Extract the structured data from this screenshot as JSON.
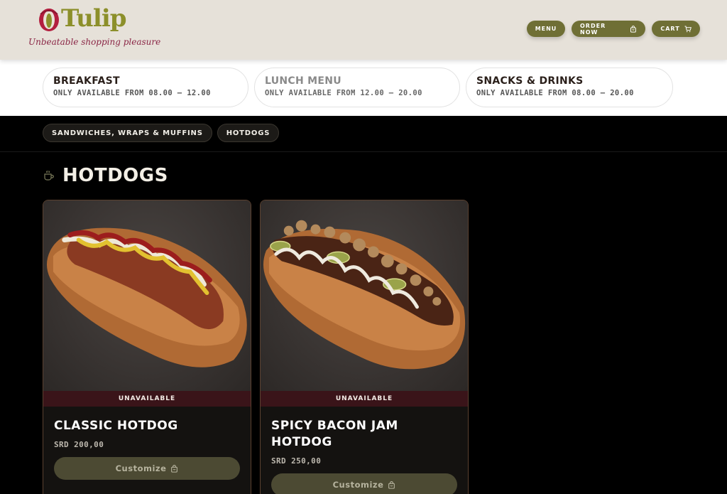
{
  "brand": {
    "name": "Tulip",
    "tagline": "Unbeatable shopping pleasure",
    "colors": {
      "olive": "#6f6f35",
      "maroon": "#3a1419",
      "header_bg": "#e6e1d9"
    }
  },
  "nav": {
    "menu_label": "MENU",
    "order_label": "ORDER NOW",
    "cart_label": "CART",
    "order_icon": "bag-icon",
    "cart_icon": "cart-icon"
  },
  "menus": [
    {
      "title": "BREAKFAST",
      "subtitle": "ONLY AVAILABLE FROM 08.00 – 12.00"
    },
    {
      "title": "LUNCH MENU",
      "subtitle": "ONLY AVAILABLE FROM 12.00 – 20.00"
    },
    {
      "title": "SNACKS & DRINKS",
      "subtitle": "ONLY AVAILABLE FROM 08.00 – 20.00"
    }
  ],
  "categories": [
    {
      "label": "SANDWICHES, WRAPS & MUFFINS"
    },
    {
      "label": "HOTDOGS"
    }
  ],
  "section": {
    "title": "HOTDOGS",
    "icon": "coffee-cup-icon"
  },
  "products": [
    {
      "name": "CLASSIC HOTDOG",
      "status": "UNAVAILABLE",
      "price": "SRD 200,00",
      "button_label": "Customize",
      "button_icon": "bag-icon"
    },
    {
      "name": "SPICY BACON JAM HOTDOG",
      "status": "UNAVAILABLE",
      "price": "SRD 250,00",
      "button_label": "Customize",
      "button_icon": "bag-icon"
    }
  ]
}
